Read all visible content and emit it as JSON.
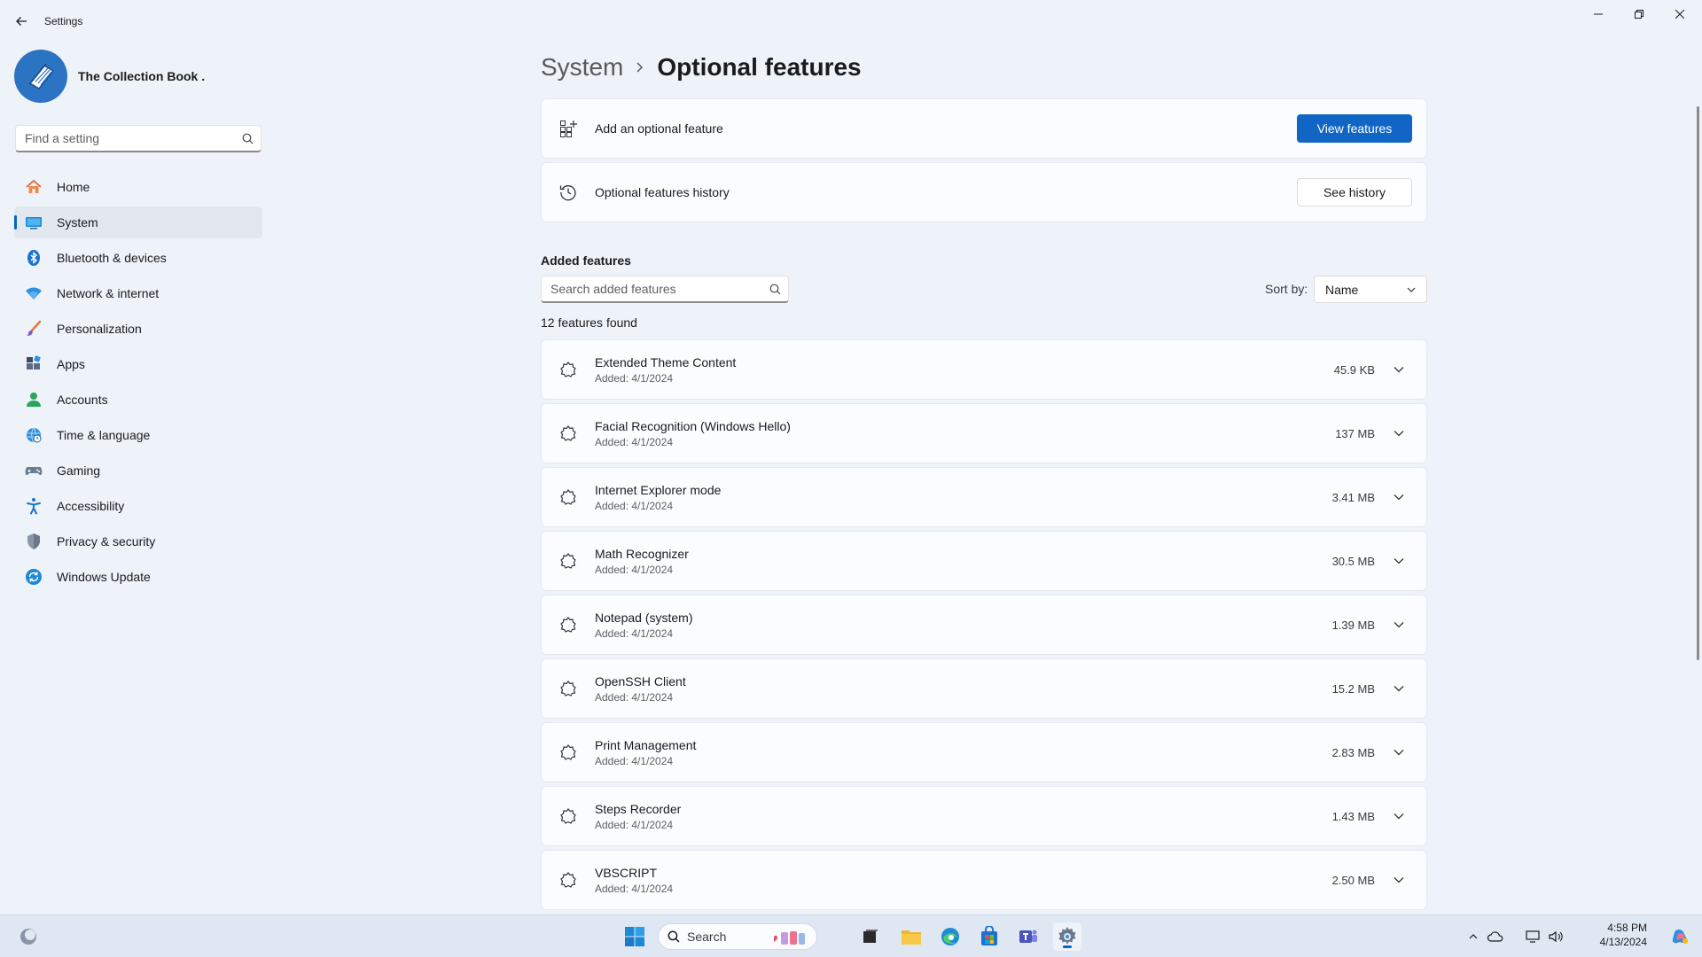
{
  "window": {
    "title": "Settings"
  },
  "profile": {
    "name": "The Collection Book ."
  },
  "search": {
    "placeholder": "Find a setting"
  },
  "nav": {
    "items": [
      {
        "label": "Home"
      },
      {
        "label": "System"
      },
      {
        "label": "Bluetooth & devices"
      },
      {
        "label": "Network & internet"
      },
      {
        "label": "Personalization"
      },
      {
        "label": "Apps"
      },
      {
        "label": "Accounts"
      },
      {
        "label": "Time & language"
      },
      {
        "label": "Gaming"
      },
      {
        "label": "Accessibility"
      },
      {
        "label": "Privacy & security"
      },
      {
        "label": "Windows Update"
      }
    ]
  },
  "breadcrumb": {
    "parent": "System",
    "current": "Optional features"
  },
  "add_feature": {
    "label": "Add an optional feature",
    "button": "View features"
  },
  "history": {
    "label": "Optional features history",
    "button": "See history"
  },
  "added": {
    "title": "Added features",
    "search_placeholder": "Search added features",
    "sort_label": "Sort by:",
    "sort_value": "Name",
    "count": "12 features found",
    "items": [
      {
        "name": "Extended Theme Content",
        "date": "Added: 4/1/2024",
        "size": "45.9 KB"
      },
      {
        "name": "Facial Recognition (Windows Hello)",
        "date": "Added: 4/1/2024",
        "size": "137 MB"
      },
      {
        "name": "Internet Explorer mode",
        "date": "Added: 4/1/2024",
        "size": "3.41 MB"
      },
      {
        "name": "Math Recognizer",
        "date": "Added: 4/1/2024",
        "size": "30.5 MB"
      },
      {
        "name": "Notepad (system)",
        "date": "Added: 4/1/2024",
        "size": "1.39 MB"
      },
      {
        "name": "OpenSSH Client",
        "date": "Added: 4/1/2024",
        "size": "15.2 MB"
      },
      {
        "name": "Print Management",
        "date": "Added: 4/1/2024",
        "size": "2.83 MB"
      },
      {
        "name": "Steps Recorder",
        "date": "Added: 4/1/2024",
        "size": "1.43 MB"
      },
      {
        "name": "VBSCRIPT",
        "date": "Added: 4/1/2024",
        "size": "2.50 MB"
      }
    ]
  },
  "taskbar": {
    "search_label": "Search",
    "time": "4:58 PM",
    "date": "4/13/2024"
  },
  "colors": {
    "accent": "#0067c0",
    "primary_button": "#1065c5",
    "background": "#eef2f9",
    "card": "#fbfcfe"
  }
}
